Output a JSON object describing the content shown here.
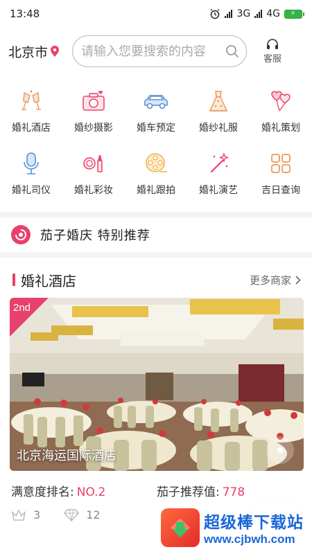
{
  "status_bar": {
    "time": "13:48",
    "network1": "3G",
    "network2": "4G"
  },
  "header": {
    "city": "北京市",
    "search_placeholder": "请输入您要搜索的内容",
    "service_label": "客服"
  },
  "categories": [
    {
      "label": "婚礼酒店",
      "icon": "champagne-glasses-icon"
    },
    {
      "label": "婚纱摄影",
      "icon": "camera-heart-icon"
    },
    {
      "label": "婚车预定",
      "icon": "car-icon"
    },
    {
      "label": "婚纱礼服",
      "icon": "wedding-dress-icon"
    },
    {
      "label": "婚礼策划",
      "icon": "heart-balloons-icon"
    },
    {
      "label": "婚礼司仪",
      "icon": "microphone-icon"
    },
    {
      "label": "婚礼彩妆",
      "icon": "makeup-icon"
    },
    {
      "label": "婚礼跟拍",
      "icon": "film-reel-icon"
    },
    {
      "label": "婚礼演艺",
      "icon": "magic-wand-icon"
    },
    {
      "label": "吉日查询",
      "icon": "calendar-grid-icon"
    }
  ],
  "recommend": {
    "title": "茄子婚庆  特别推荐"
  },
  "section": {
    "title": "婚礼酒店",
    "more": "更多商家"
  },
  "hotel_card": {
    "rank_badge": "2nd",
    "name": "北京海运国际酒店",
    "satisfaction_label": "满意度排名:",
    "satisfaction_value": "NO.2",
    "recommend_label": "茄子推荐值:",
    "recommend_value": "778",
    "crown_count": "3",
    "diamond_count": "12"
  },
  "watermark": {
    "title": "超级棒下载站",
    "url": "www.cjbwh.com"
  },
  "colors": {
    "accent": "#e8416b",
    "icon_blue": "#5a8fd6",
    "icon_orange": "#f0a86a"
  }
}
